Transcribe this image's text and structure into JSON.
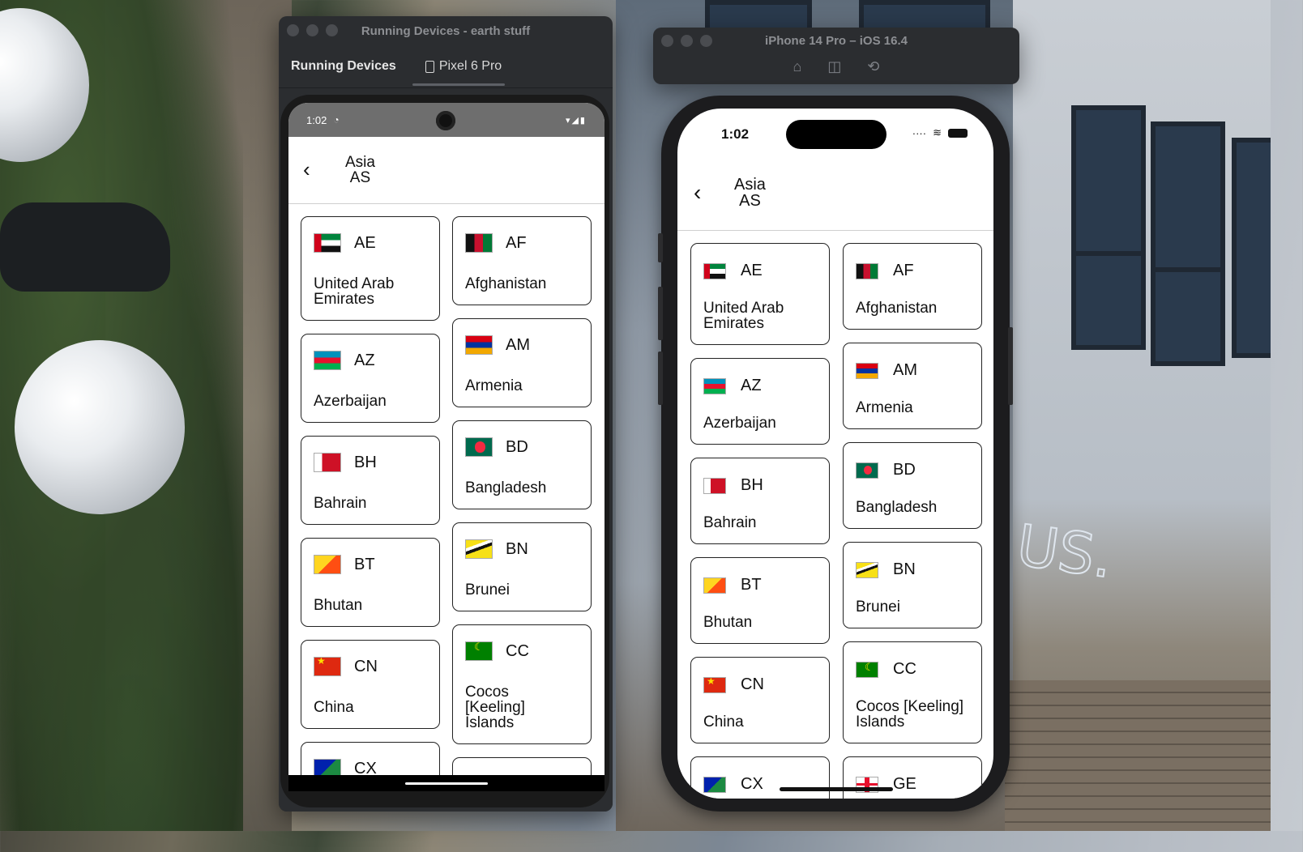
{
  "android_window": {
    "title": "Running Devices - earth stuff",
    "tab_primary": "Running Devices",
    "tab_device": "Pixel 6 Pro",
    "status_time": "1:02"
  },
  "ios_window": {
    "title": "iPhone 14 Pro – iOS 16.4",
    "status_time": "1:02"
  },
  "screen": {
    "back_icon": "chevron-left-icon",
    "title_line1": "Asia",
    "title_line2": "AS"
  },
  "countries": [
    {
      "code": "AE",
      "name": "United Arab Emirates",
      "flag": "uae-flag-icon"
    },
    {
      "code": "AF",
      "name": "Afghanistan",
      "flag": "afghanistan-flag-icon"
    },
    {
      "code": "AZ",
      "name": "Azerbaijan",
      "flag": "azerbaijan-flag-icon"
    },
    {
      "code": "AM",
      "name": "Armenia",
      "flag": "armenia-flag-icon"
    },
    {
      "code": "BH",
      "name": "Bahrain",
      "flag": "bahrain-flag-icon"
    },
    {
      "code": "BD",
      "name": "Bangladesh",
      "flag": "bangladesh-flag-icon"
    },
    {
      "code": "BT",
      "name": "Bhutan",
      "flag": "bhutan-flag-icon"
    },
    {
      "code": "BN",
      "name": "Brunei",
      "flag": "brunei-flag-icon"
    },
    {
      "code": "CN",
      "name": "China",
      "flag": "china-flag-icon"
    },
    {
      "code": "CC",
      "name": "Cocos [Keeling] Islands",
      "flag": "cocos-flag-icon"
    },
    {
      "code": "CX",
      "name": "",
      "flag": "christmas-island-flag-icon"
    },
    {
      "code": "GE",
      "name": "",
      "flag": "georgia-flag-icon"
    }
  ],
  "android_partial": {
    "code_clipped": "CX"
  }
}
